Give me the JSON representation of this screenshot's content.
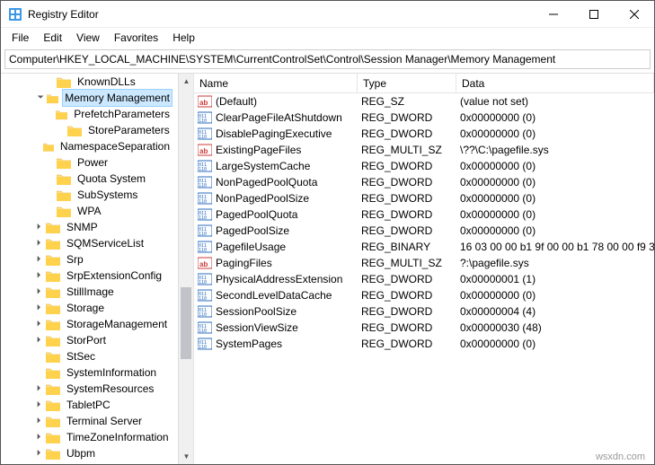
{
  "window": {
    "title": "Registry Editor"
  },
  "menu": {
    "file": "File",
    "edit": "Edit",
    "view": "View",
    "favorites": "Favorites",
    "help": "Help"
  },
  "address": "Computer\\HKEY_LOCAL_MACHINE\\SYSTEM\\CurrentControlSet\\Control\\Session Manager\\Memory Management",
  "tree": [
    {
      "label": "KnownDLLs",
      "depth": 4,
      "toggle": ""
    },
    {
      "label": "Memory Management",
      "depth": 4,
      "toggle": "expanded",
      "selected": true
    },
    {
      "label": "PrefetchParameters",
      "depth": 5,
      "toggle": ""
    },
    {
      "label": "StoreParameters",
      "depth": 5,
      "toggle": ""
    },
    {
      "label": "NamespaceSeparation",
      "depth": 4,
      "toggle": ""
    },
    {
      "label": "Power",
      "depth": 4,
      "toggle": ""
    },
    {
      "label": "Quota System",
      "depth": 4,
      "toggle": ""
    },
    {
      "label": "SubSystems",
      "depth": 4,
      "toggle": ""
    },
    {
      "label": "WPA",
      "depth": 4,
      "toggle": ""
    },
    {
      "label": "SNMP",
      "depth": 3,
      "toggle": "collapsed"
    },
    {
      "label": "SQMServiceList",
      "depth": 3,
      "toggle": "collapsed"
    },
    {
      "label": "Srp",
      "depth": 3,
      "toggle": "collapsed"
    },
    {
      "label": "SrpExtensionConfig",
      "depth": 3,
      "toggle": "collapsed"
    },
    {
      "label": "StillImage",
      "depth": 3,
      "toggle": "collapsed"
    },
    {
      "label": "Storage",
      "depth": 3,
      "toggle": "collapsed"
    },
    {
      "label": "StorageManagement",
      "depth": 3,
      "toggle": "collapsed"
    },
    {
      "label": "StorPort",
      "depth": 3,
      "toggle": "collapsed"
    },
    {
      "label": "StSec",
      "depth": 3,
      "toggle": ""
    },
    {
      "label": "SystemInformation",
      "depth": 3,
      "toggle": ""
    },
    {
      "label": "SystemResources",
      "depth": 3,
      "toggle": "collapsed"
    },
    {
      "label": "TabletPC",
      "depth": 3,
      "toggle": "collapsed"
    },
    {
      "label": "Terminal Server",
      "depth": 3,
      "toggle": "collapsed"
    },
    {
      "label": "TimeZoneInformation",
      "depth": 3,
      "toggle": "collapsed"
    },
    {
      "label": "Ubpm",
      "depth": 3,
      "toggle": "collapsed"
    }
  ],
  "list": {
    "headers": {
      "name": "Name",
      "type": "Type",
      "data": "Data"
    },
    "rows": [
      {
        "icon": "sz",
        "name": "(Default)",
        "type": "REG_SZ",
        "data": "(value not set)"
      },
      {
        "icon": "bin",
        "name": "ClearPageFileAtShutdown",
        "type": "REG_DWORD",
        "data": "0x00000000 (0)"
      },
      {
        "icon": "bin",
        "name": "DisablePagingExecutive",
        "type": "REG_DWORD",
        "data": "0x00000000 (0)"
      },
      {
        "icon": "sz",
        "name": "ExistingPageFiles",
        "type": "REG_MULTI_SZ",
        "data": "\\??\\C:\\pagefile.sys"
      },
      {
        "icon": "bin",
        "name": "LargeSystemCache",
        "type": "REG_DWORD",
        "data": "0x00000000 (0)"
      },
      {
        "icon": "bin",
        "name": "NonPagedPoolQuota",
        "type": "REG_DWORD",
        "data": "0x00000000 (0)"
      },
      {
        "icon": "bin",
        "name": "NonPagedPoolSize",
        "type": "REG_DWORD",
        "data": "0x00000000 (0)"
      },
      {
        "icon": "bin",
        "name": "PagedPoolQuota",
        "type": "REG_DWORD",
        "data": "0x00000000 (0)"
      },
      {
        "icon": "bin",
        "name": "PagedPoolSize",
        "type": "REG_DWORD",
        "data": "0x00000000 (0)"
      },
      {
        "icon": "bin",
        "name": "PagefileUsage",
        "type": "REG_BINARY",
        "data": "16 03 00 00 b1 9f 00 00 b1 78 00 00 f9 3"
      },
      {
        "icon": "sz",
        "name": "PagingFiles",
        "type": "REG_MULTI_SZ",
        "data": "?:\\pagefile.sys"
      },
      {
        "icon": "bin",
        "name": "PhysicalAddressExtension",
        "type": "REG_DWORD",
        "data": "0x00000001 (1)"
      },
      {
        "icon": "bin",
        "name": "SecondLevelDataCache",
        "type": "REG_DWORD",
        "data": "0x00000000 (0)"
      },
      {
        "icon": "bin",
        "name": "SessionPoolSize",
        "type": "REG_DWORD",
        "data": "0x00000004 (4)"
      },
      {
        "icon": "bin",
        "name": "SessionViewSize",
        "type": "REG_DWORD",
        "data": "0x00000030 (48)"
      },
      {
        "icon": "bin",
        "name": "SystemPages",
        "type": "REG_DWORD",
        "data": "0x00000000 (0)"
      }
    ]
  },
  "watermark": "wsxdn.com"
}
